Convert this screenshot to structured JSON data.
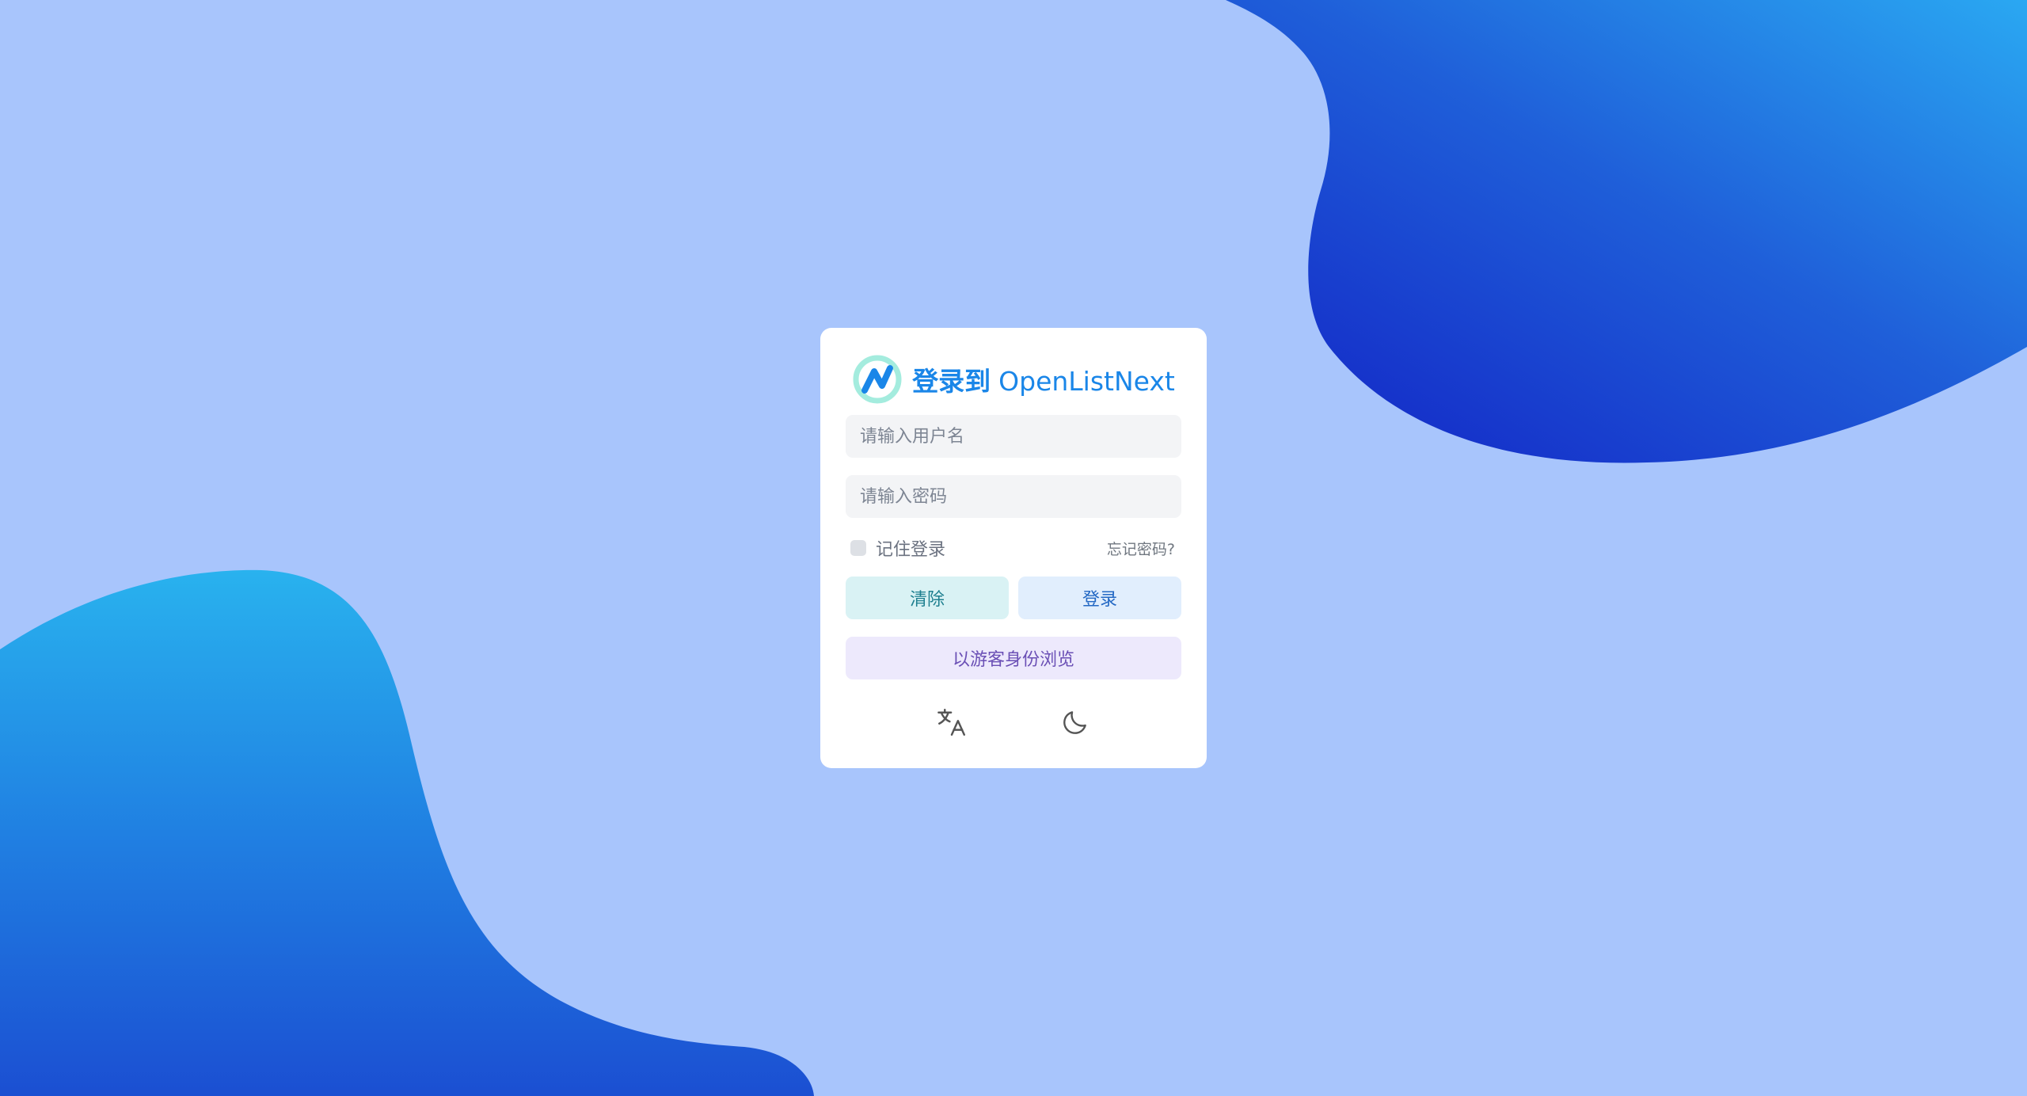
{
  "colors": {
    "background": "#a8c5fc",
    "brand": "#1a86e8",
    "card": "#ffffff",
    "input_bg": "#f3f4f6",
    "clear_bg": "#d9f2f4",
    "login_bg": "#e1eefd",
    "guest_bg": "#ede9fc"
  },
  "header": {
    "logo_icon": "openlist-logo-icon",
    "title_prefix": "登录到",
    "title_name": "OpenListNext"
  },
  "form": {
    "username_placeholder": "请输入用户名",
    "username_value": "",
    "password_placeholder": "请输入密码",
    "password_value": "",
    "remember_label": "记住登录",
    "remember_checked": false,
    "forgot_label": "忘记密码?"
  },
  "buttons": {
    "clear_label": "清除",
    "login_label": "登录",
    "guest_label": "以游客身份浏览"
  },
  "footer_icons": {
    "language": "translate-icon",
    "theme": "moon-icon"
  }
}
